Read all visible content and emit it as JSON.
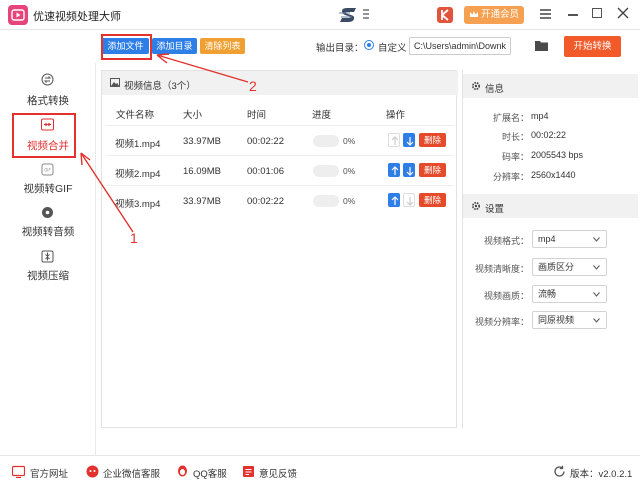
{
  "app": {
    "title": "优速视频处理大师"
  },
  "titlebar": {
    "vip_label": "开通会员"
  },
  "toolbar": {
    "add_file": "添加文件",
    "add_dir": "添加目录",
    "clear_list": "清除列表",
    "output_label": "输出目录：",
    "custom_label": "自定义",
    "path_value": "C:\\Users\\admin\\Downk",
    "start_label": "开始转换"
  },
  "sidebar": {
    "items": [
      {
        "label": "格式转换",
        "icon": "format-convert-icon"
      },
      {
        "label": "视频合并",
        "icon": "video-merge-icon"
      },
      {
        "label": "视频转GIF",
        "icon": "gif-icon"
      },
      {
        "label": "视频转音频",
        "icon": "audio-icon"
      },
      {
        "label": "视频压缩",
        "icon": "compress-icon"
      }
    ],
    "active": "视频合并"
  },
  "list": {
    "title": "视频信息（3个）",
    "columns": {
      "name": "文件名称",
      "size": "大小",
      "time": "时间",
      "progress": "进度",
      "action": "操作"
    },
    "delete_label": "删除",
    "rows": [
      {
        "name": "视频1.mp4",
        "size": "33.97MB",
        "time": "00:02:22",
        "progress": "0%",
        "up_enabled": false,
        "down_enabled": true
      },
      {
        "name": "视频2.mp4",
        "size": "16.09MB",
        "time": "00:01:06",
        "progress": "0%",
        "up_enabled": true,
        "down_enabled": true
      },
      {
        "name": "视频3.mp4",
        "size": "33.97MB",
        "time": "00:02:22",
        "progress": "0%",
        "up_enabled": true,
        "down_enabled": false
      }
    ]
  },
  "info": {
    "title": "信息",
    "fields": [
      {
        "key": "扩展名：",
        "value": "mp4"
      },
      {
        "key": "时长：",
        "value": "00:02:22"
      },
      {
        "key": "码率：",
        "value": "2005543 bps"
      },
      {
        "key": "分辨率：",
        "value": "2560x1440"
      }
    ]
  },
  "settings": {
    "title": "设置",
    "fields": [
      {
        "key": "视频格式：",
        "value": "mp4"
      },
      {
        "key": "视频清晰度：",
        "value": "画质区分"
      },
      {
        "key": "视频画质：",
        "value": "流畅"
      },
      {
        "key": "视频分辨率：",
        "value": "同原视频"
      }
    ]
  },
  "footer": {
    "website": "官方网址",
    "wechat": "企业微信客服",
    "qq": "QQ客服",
    "feedback": "意见反馈",
    "version": "版本：v2.0.2.1"
  },
  "annotations": {
    "label_1": "1",
    "label_2": "2"
  },
  "colors": {
    "accent": "#2e7ee8",
    "danger": "#e54a2a",
    "warning": "#f0a033",
    "annotation": "#e3322e"
  }
}
